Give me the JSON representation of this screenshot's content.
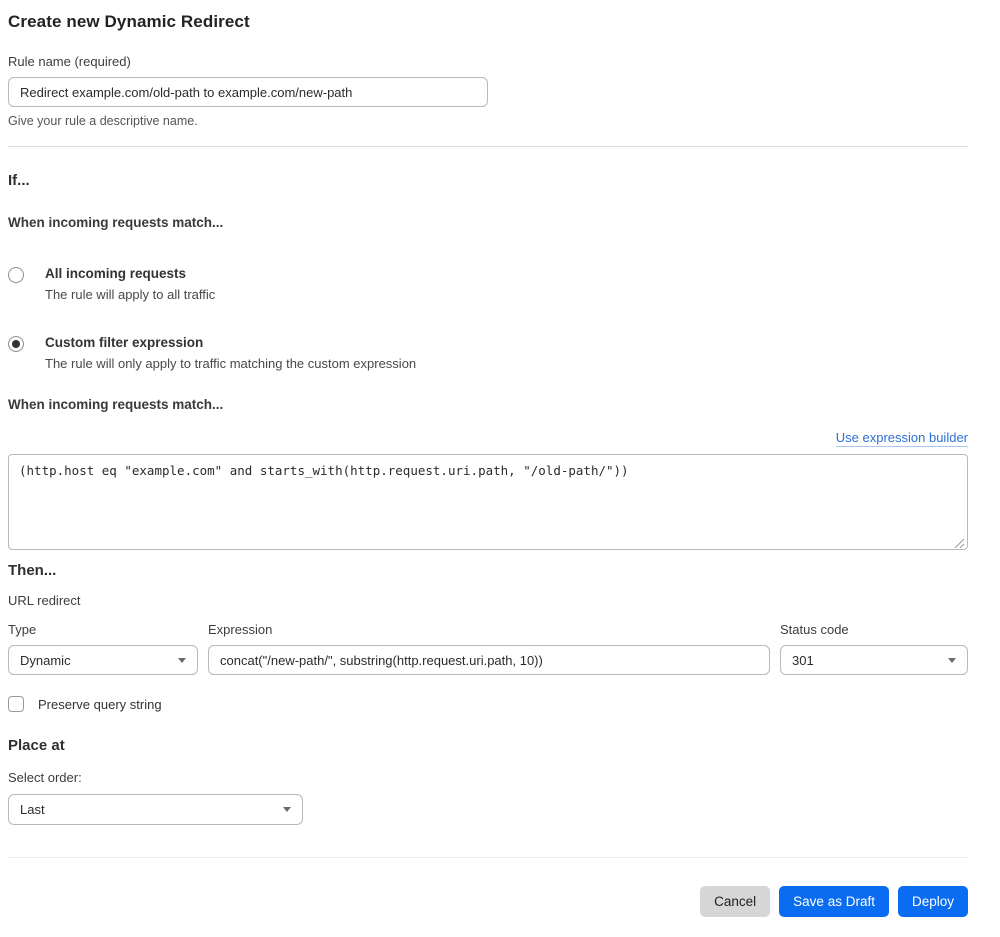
{
  "page": {
    "title": "Create new Dynamic Redirect"
  },
  "rule_name": {
    "label": "Rule name (required)",
    "value": "Redirect example.com/old-path to example.com/new-path",
    "help": "Give your rule a descriptive name."
  },
  "if_section": {
    "heading": "If...",
    "match_heading": "When incoming requests match...",
    "options": [
      {
        "label": "All incoming requests",
        "description": "The rule will apply to all traffic",
        "selected": false
      },
      {
        "label": "Custom filter expression",
        "description": "The rule will only apply to traffic matching the custom expression",
        "selected": true
      }
    ],
    "expression_heading": "When incoming requests match...",
    "builder_link": "Use expression builder",
    "expression_value": "(http.host eq \"example.com\" and starts_with(http.request.uri.path, \"/old-path/\"))"
  },
  "then_section": {
    "heading": "Then...",
    "action_label": "URL redirect",
    "type": {
      "label": "Type",
      "value": "Dynamic"
    },
    "expression": {
      "label": "Expression",
      "value": "concat(\"/new-path/\", substring(http.request.uri.path, 10))"
    },
    "status_code": {
      "label": "Status code",
      "value": "301"
    },
    "preserve_query_label": "Preserve query string"
  },
  "place_at": {
    "heading": "Place at",
    "label": "Select order:",
    "value": "Last"
  },
  "footer": {
    "cancel": "Cancel",
    "save_draft": "Save as Draft",
    "deploy": "Deploy"
  },
  "colors": {
    "accent_blue": "#0a6cf1",
    "link_blue": "#2e6fd6",
    "cancel_gray": "#d6d6d6"
  }
}
